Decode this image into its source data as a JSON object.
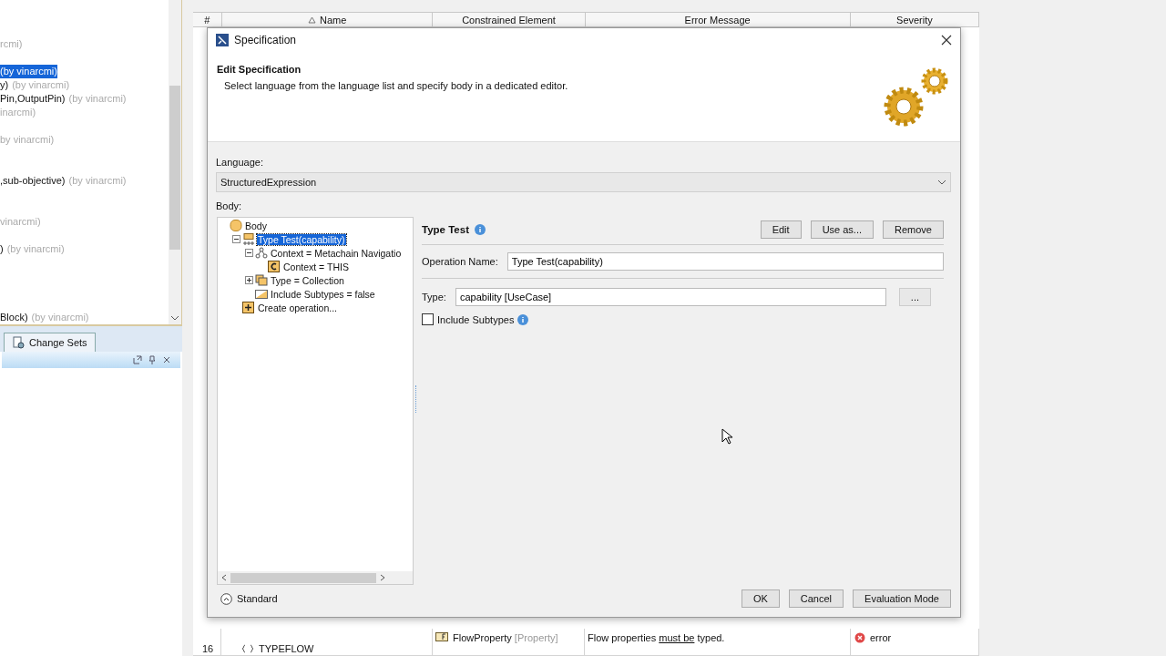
{
  "left_panel": {
    "items": [
      {
        "note": "rcmi)",
        "selected": false
      },
      {
        "note": "(by vinarcmi)",
        "selected": true
      },
      {
        "text": "y)",
        "note": "(by vinarcmi)",
        "selected": false
      },
      {
        "text": "Pin,OutputPin)",
        "note": "(by vinarcmi)",
        "selected": false
      },
      {
        "note": "inarcmi)",
        "selected": false
      },
      {
        "note": "by vinarcmi)",
        "selected": false
      },
      {
        "text": ",sub-objective)",
        "note": "(by vinarcmi)",
        "selected": false
      },
      {
        "note": "vinarcmi)",
        "selected": false
      },
      {
        "text": ")",
        "note": "(by vinarcmi)",
        "selected": false
      },
      {
        "text": "Block)",
        "note": "(by vinarcmi)",
        "selected": false
      }
    ],
    "tab": "Change Sets"
  },
  "table": {
    "columns": [
      "#",
      "Name",
      "Constrained Element",
      "Error Message",
      "Severity"
    ],
    "rows": [
      {
        "number": "16",
        "name": "TYPEFLOW",
        "element": "FlowProperty",
        "element_type": "[Property]",
        "message": {
          "before": "Flow properties ",
          "link": "must be",
          "after": " typed."
        },
        "severity": "error"
      }
    ]
  },
  "dialog": {
    "title": "Specification",
    "heading": "Edit Specification",
    "subtitle": "Select language from the language list and specify body in a dedicated editor.",
    "language_label": "Language:",
    "language": "StructuredExpression",
    "body_label": "Body:",
    "tree": [
      {
        "label": "Body",
        "kind": "body",
        "selected": false,
        "children": [
          {
            "label": "Type Test(capability)",
            "kind": "operation",
            "selected": true,
            "expanded": true,
            "children": [
              {
                "label": "Context = Metachain Navigatio",
                "kind": "metachain",
                "selected": false,
                "expanded": true,
                "children": [
                  {
                    "label": "Context = THIS",
                    "kind": "context",
                    "selected": false
                  }
                ]
              },
              {
                "label": "Type = Collection",
                "kind": "collection",
                "selected": false,
                "expanded": false
              },
              {
                "label": "Include Subtypes = false",
                "kind": "property",
                "selected": false
              }
            ]
          },
          {
            "label": "Create operation...",
            "kind": "create",
            "selected": false
          }
        ]
      }
    ],
    "detail": {
      "title": "Type Test",
      "buttons": [
        "Edit",
        "Use as...",
        "Remove"
      ],
      "operation_label": "Operation Name:",
      "operation_value": "Type Test(capability)",
      "type_label": "Type:",
      "type_value": "capability [UseCase]",
      "browse": "...",
      "include_label": "Include Subtypes",
      "include_checked": false
    },
    "mode": "Standard",
    "footer_buttons": [
      "OK",
      "Cancel",
      "Evaluation Mode"
    ]
  }
}
